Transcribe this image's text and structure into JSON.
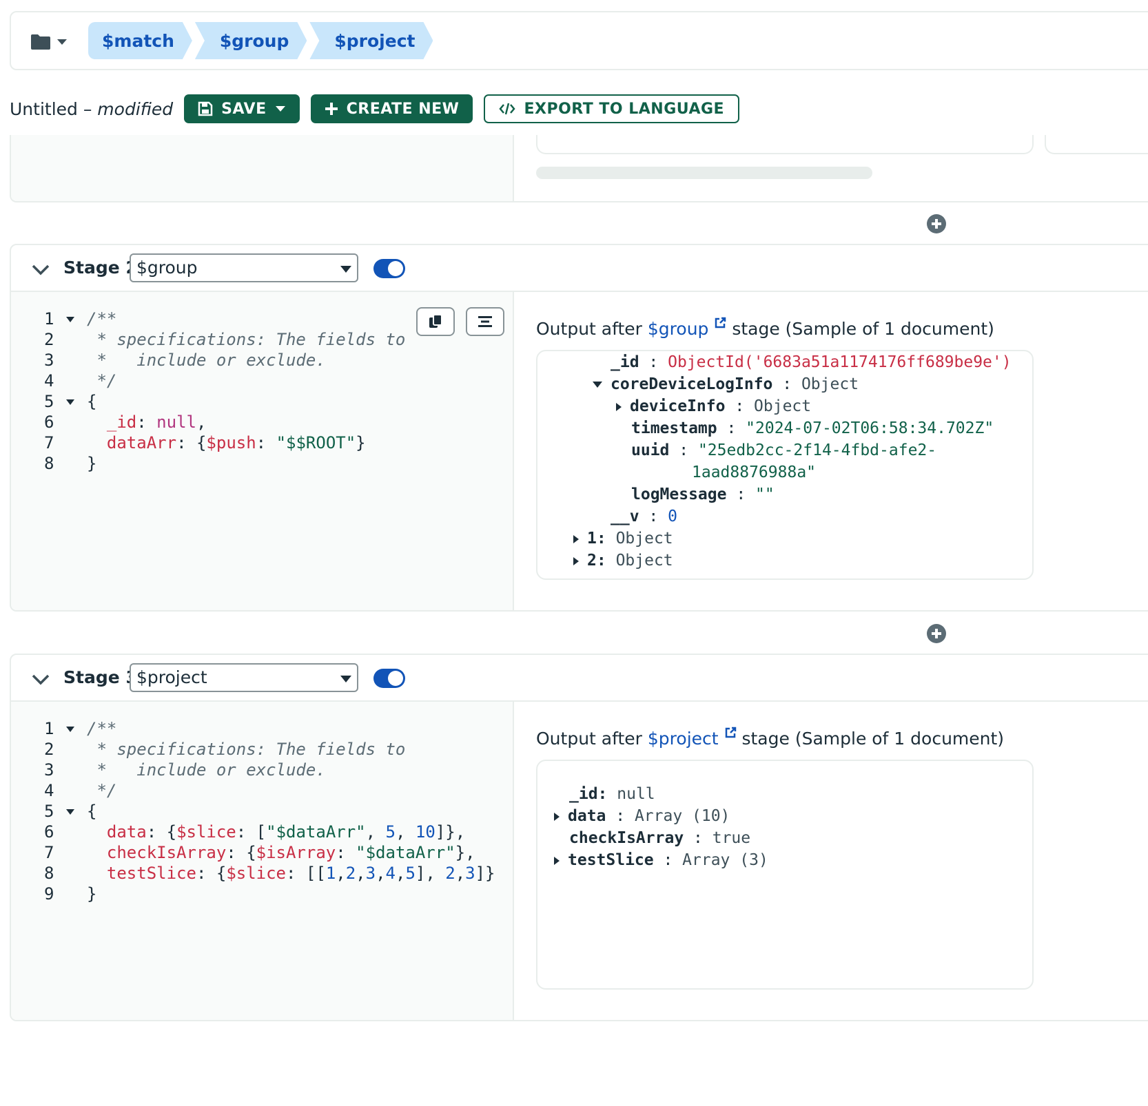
{
  "breadcrumb": {
    "stages": [
      "$match",
      "$group",
      "$project"
    ]
  },
  "toolbar": {
    "title": "Untitled",
    "separator": " – ",
    "modified": "modified",
    "save_label": "SAVE",
    "create_new_label": "CREATE NEW",
    "export_label": "EXPORT TO LANGUAGE"
  },
  "stage2": {
    "label": "Stage 2",
    "operator": "$group",
    "enabled": true,
    "line_numbers": [
      "1",
      "2",
      "3",
      "4",
      "5",
      "6",
      "7",
      "8"
    ],
    "code": {
      "l1": "/**",
      "l2": " * specifications: The fields to",
      "l3": " *   include or exclude.",
      "l4": " */",
      "l5": "{",
      "l6_key": "_id",
      "l6_val": "null",
      "l7_key": "dataArr",
      "l7_op": "$push",
      "l7_val": "\"$$ROOT\"",
      "l8": "}"
    },
    "output": {
      "prefix": "Output after ",
      "link": "$group",
      "suffix": " stage (Sample of 1 document)",
      "id_key": "_id",
      "id_val": "ObjectId('6683a51a1174176ff689be9e')",
      "core_key": "coreDeviceLogInfo",
      "core_val": "Object",
      "device_key": "deviceInfo",
      "device_val": "Object",
      "ts_key": "timestamp",
      "ts_val": "\"2024-07-02T06:58:34.702Z\"",
      "uuid_key": "uuid",
      "uuid_val_1": "\"25edb2cc-2f14-4fbd-afe2-",
      "uuid_val_2": "1aad8876988a\"",
      "log_key": "logMessage",
      "log_val": "\"\"",
      "v_key": "__v",
      "v_val": "0",
      "item1_key": "1:",
      "item1_val": "Object",
      "item2_key": "2:",
      "item2_val": "Object"
    }
  },
  "stage3": {
    "label": "Stage 3",
    "operator": "$project",
    "enabled": true,
    "line_numbers": [
      "1",
      "2",
      "3",
      "4",
      "5",
      "6",
      "7",
      "8",
      "9"
    ],
    "code": {
      "l1": "/**",
      "l2": " * specifications: The fields to",
      "l3": " *   include or exclude.",
      "l4": " */",
      "l5": "{",
      "l6_key": "data",
      "l6_op": "$slice",
      "l6_str": "\"$dataArr\"",
      "l6_n1": "5",
      "l6_n2": "10",
      "l7_key": "checkIsArray",
      "l7_op": "$isArray",
      "l7_str": "\"$dataArr\"",
      "l8_key": "testSlice",
      "l8_op": "$slice",
      "l8_arr": [
        "1",
        "2",
        "3",
        "4",
        "5"
      ],
      "l8_n1": "2",
      "l8_n2": "3",
      "l9": "}"
    },
    "output": {
      "prefix": "Output after ",
      "link": "$project",
      "suffix": " stage (Sample of 1 document)",
      "id_key": "_id:",
      "id_val": "null",
      "data_key": "data",
      "data_val": "Array (10)",
      "check_key": "checkIsArray",
      "check_val": "true",
      "slice_key": "testSlice",
      "slice_val": "Array (3)"
    }
  },
  "colors": {
    "brand_green": "#116149",
    "link_blue": "#1254b7",
    "breadcrumb_bg": "#c9e6fb",
    "key_red": "#c82e45"
  }
}
